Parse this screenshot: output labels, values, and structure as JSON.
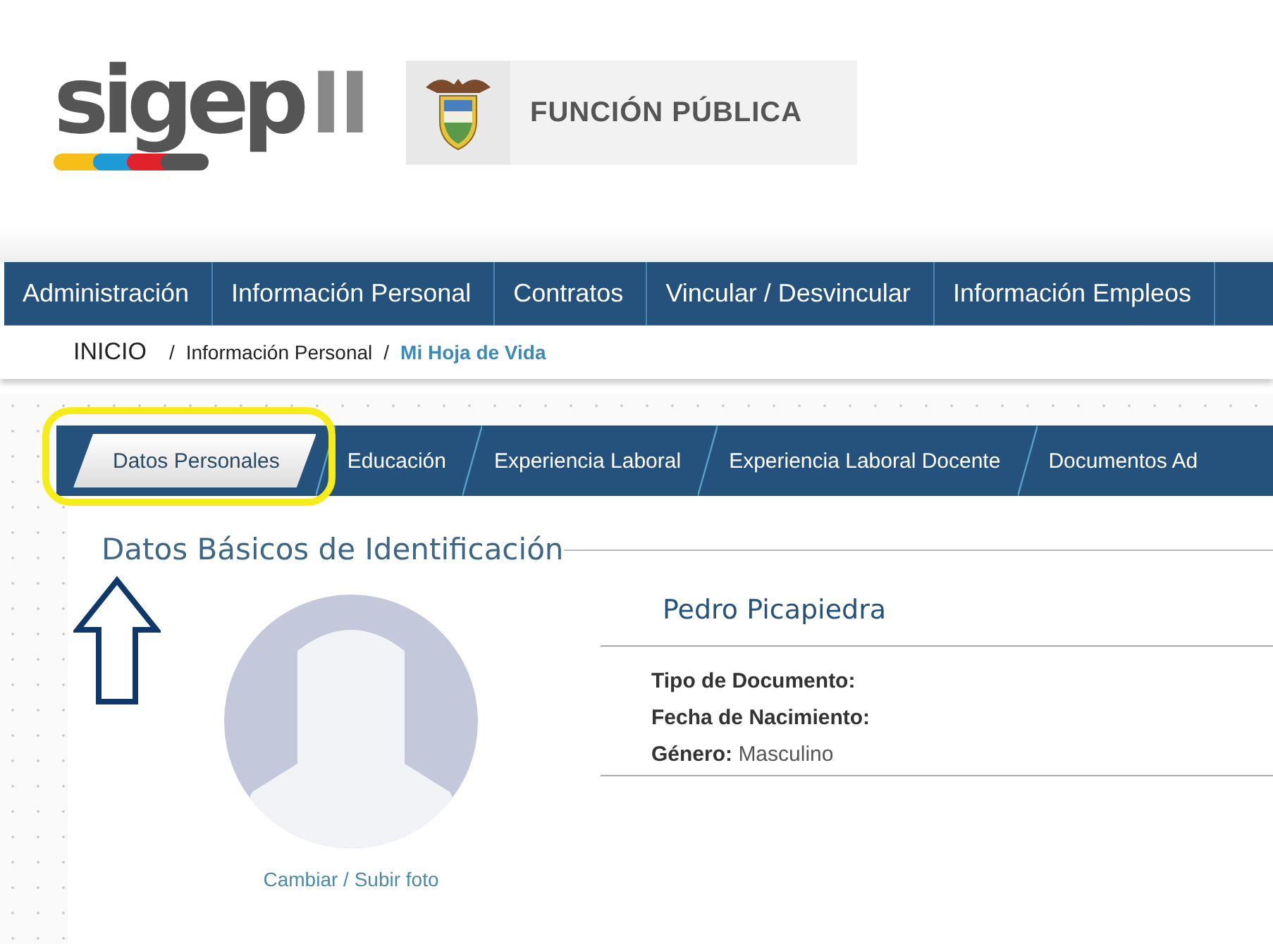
{
  "logo": {
    "text": "sigep",
    "suffix": "II"
  },
  "institution": {
    "name": "FUNCIÓN PÚBLICA"
  },
  "menu": [
    {
      "label": "Administración"
    },
    {
      "label": "Información Personal"
    },
    {
      "label": "Contratos"
    },
    {
      "label": "Vincular / Desvincular"
    },
    {
      "label": "Información Empleos"
    }
  ],
  "breadcrumb": [
    {
      "label": "INICIO",
      "kind": "home"
    },
    {
      "separator": "/",
      "label": "Información Personal",
      "kind": "link"
    },
    {
      "separator": "/",
      "label": "Mi Hoja de Vida",
      "kind": "current"
    }
  ],
  "tabs": [
    {
      "label": "Datos Personales",
      "selected": true
    },
    {
      "label": "Educación",
      "selected": false
    },
    {
      "label": "Experiencia Laboral",
      "selected": false
    },
    {
      "label": "Experiencia Laboral Docente",
      "selected": false
    },
    {
      "label": "Documentos Ad",
      "selected": false
    }
  ],
  "section": {
    "title": "Datos Básicos de Identificación"
  },
  "profile": {
    "name": "Pedro Picapiedra",
    "photo_link": "Cambiar / Subir foto",
    "fields": [
      {
        "label": "Tipo de Documento:"
      },
      {
        "label": "Fecha de Nacimiento:"
      },
      {
        "label": "Género:",
        "value": "Masculino"
      }
    ]
  },
  "annotation": {
    "kind": "highlight-arrow"
  }
}
